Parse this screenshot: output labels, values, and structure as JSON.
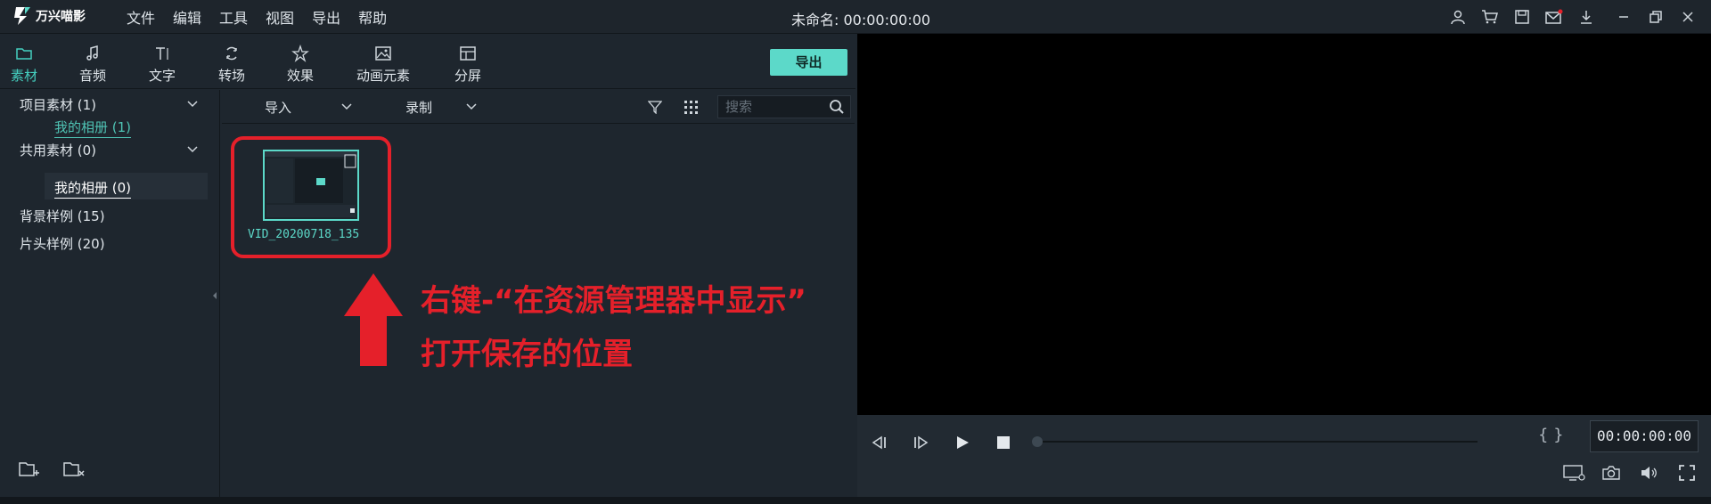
{
  "app": {
    "logo_text": "万兴喵影",
    "menu": [
      "文件",
      "编辑",
      "工具",
      "视图",
      "导出",
      "帮助"
    ],
    "doc_title": "未命名: 00:00:00:00"
  },
  "toolbar": {
    "tabs": [
      {
        "label": "素材",
        "icon": "folder-icon"
      },
      {
        "label": "音频",
        "icon": "music-note-icon"
      },
      {
        "label": "文字",
        "icon": "text-icon"
      },
      {
        "label": "转场",
        "icon": "transition-icon"
      },
      {
        "label": "效果",
        "icon": "effects-icon"
      },
      {
        "label": "动画元素",
        "icon": "image-icon"
      },
      {
        "label": "分屏",
        "icon": "split-screen-icon"
      }
    ],
    "export_label": "导出"
  },
  "tree": {
    "items": [
      {
        "label": "项目素材 (1)"
      },
      {
        "label": "我的相册 (1)"
      },
      {
        "label": "共用素材 (0)"
      },
      {
        "label": "我的相册 (0)"
      },
      {
        "label": "背景样例 (15)"
      },
      {
        "label": "片头样例 (20)"
      }
    ]
  },
  "media": {
    "import_label": "导入",
    "record_label": "录制",
    "search_placeholder": "搜索",
    "clip_name": "VID_20200718_135"
  },
  "annotation": {
    "line1": "右键-“在资源管理器中显示”",
    "line2": "打开保存的位置",
    "color": "#e5202a"
  },
  "player": {
    "timecode": "00:00:00:00",
    "braces": "{ }"
  },
  "colors": {
    "accent": "#5cd9c9",
    "active_tab": "#45d0c0",
    "background": "#1e262e",
    "preview": "#000000"
  }
}
